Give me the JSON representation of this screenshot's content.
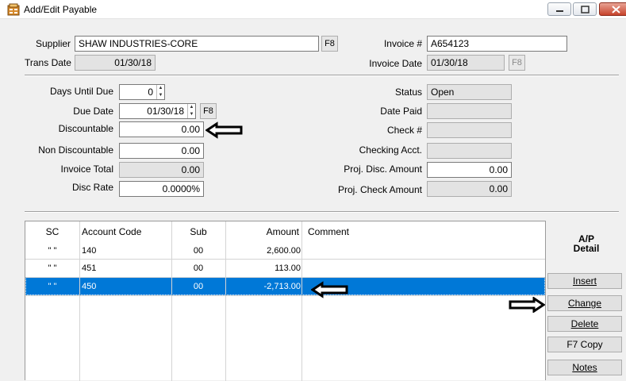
{
  "window": {
    "title": "Add/Edit Payable"
  },
  "header": {
    "supplier_label": "Supplier",
    "supplier_value": "SHAW INDUSTRIES-CORE",
    "supplier_lookup": "F8",
    "trans_date_label": "Trans Date",
    "trans_date_value": "01/30/18",
    "invoice_no_label": "Invoice #",
    "invoice_no_value": "A654123",
    "invoice_date_label": "Invoice Date",
    "invoice_date_value": "01/30/18",
    "invoice_date_lookup": "F8"
  },
  "left": {
    "days_until_due_label": "Days Until Due",
    "days_until_due_value": "0",
    "due_date_label": "Due Date",
    "due_date_value": "01/30/18",
    "due_date_lookup": "F8",
    "discountable_label": "Discountable",
    "discountable_value": "0.00",
    "non_discountable_label": "Non Discountable",
    "non_discountable_value": "0.00",
    "invoice_total_label": "Invoice Total",
    "invoice_total_value": "0.00",
    "disc_rate_label": "Disc Rate",
    "disc_rate_value": "0.0000%"
  },
  "right": {
    "status_label": "Status",
    "status_value": "Open",
    "date_paid_label": "Date Paid",
    "date_paid_value": "",
    "check_no_label": "Check #",
    "check_no_value": "",
    "checking_acct_label": "Checking Acct.",
    "checking_acct_value": "",
    "proj_disc_label": "Proj. Disc. Amount",
    "proj_disc_value": "0.00",
    "proj_check_label": "Proj. Check Amount",
    "proj_check_value": "0.00"
  },
  "grid": {
    "columns": [
      "SC",
      "Account Code",
      "Sub",
      "Amount",
      "Comment"
    ],
    "rows": [
      {
        "sc": "\" \"",
        "account": "140",
        "sub": "00",
        "amount": "2,600.00",
        "comment": ""
      },
      {
        "sc": "\" \"",
        "account": "451",
        "sub": "00",
        "amount": "113.00",
        "comment": ""
      },
      {
        "sc": "\" \"",
        "account": "450",
        "sub": "00",
        "amount": "-2,713.00",
        "comment": ""
      }
    ]
  },
  "sidebar": {
    "title_line1": "A/P",
    "title_line2": "Detail",
    "insert_label": "Insert",
    "change_label": "Change",
    "delete_label": "Delete",
    "f7copy_label": "F7 Copy",
    "notes_label": "Notes"
  },
  "colors": {
    "selection": "#0078d7",
    "annotation_arrow": "#000000"
  },
  "icons": {
    "app": "payable-app-icon",
    "arrow": "left-arrow-icon",
    "arrow_right": "right-arrow-icon"
  }
}
